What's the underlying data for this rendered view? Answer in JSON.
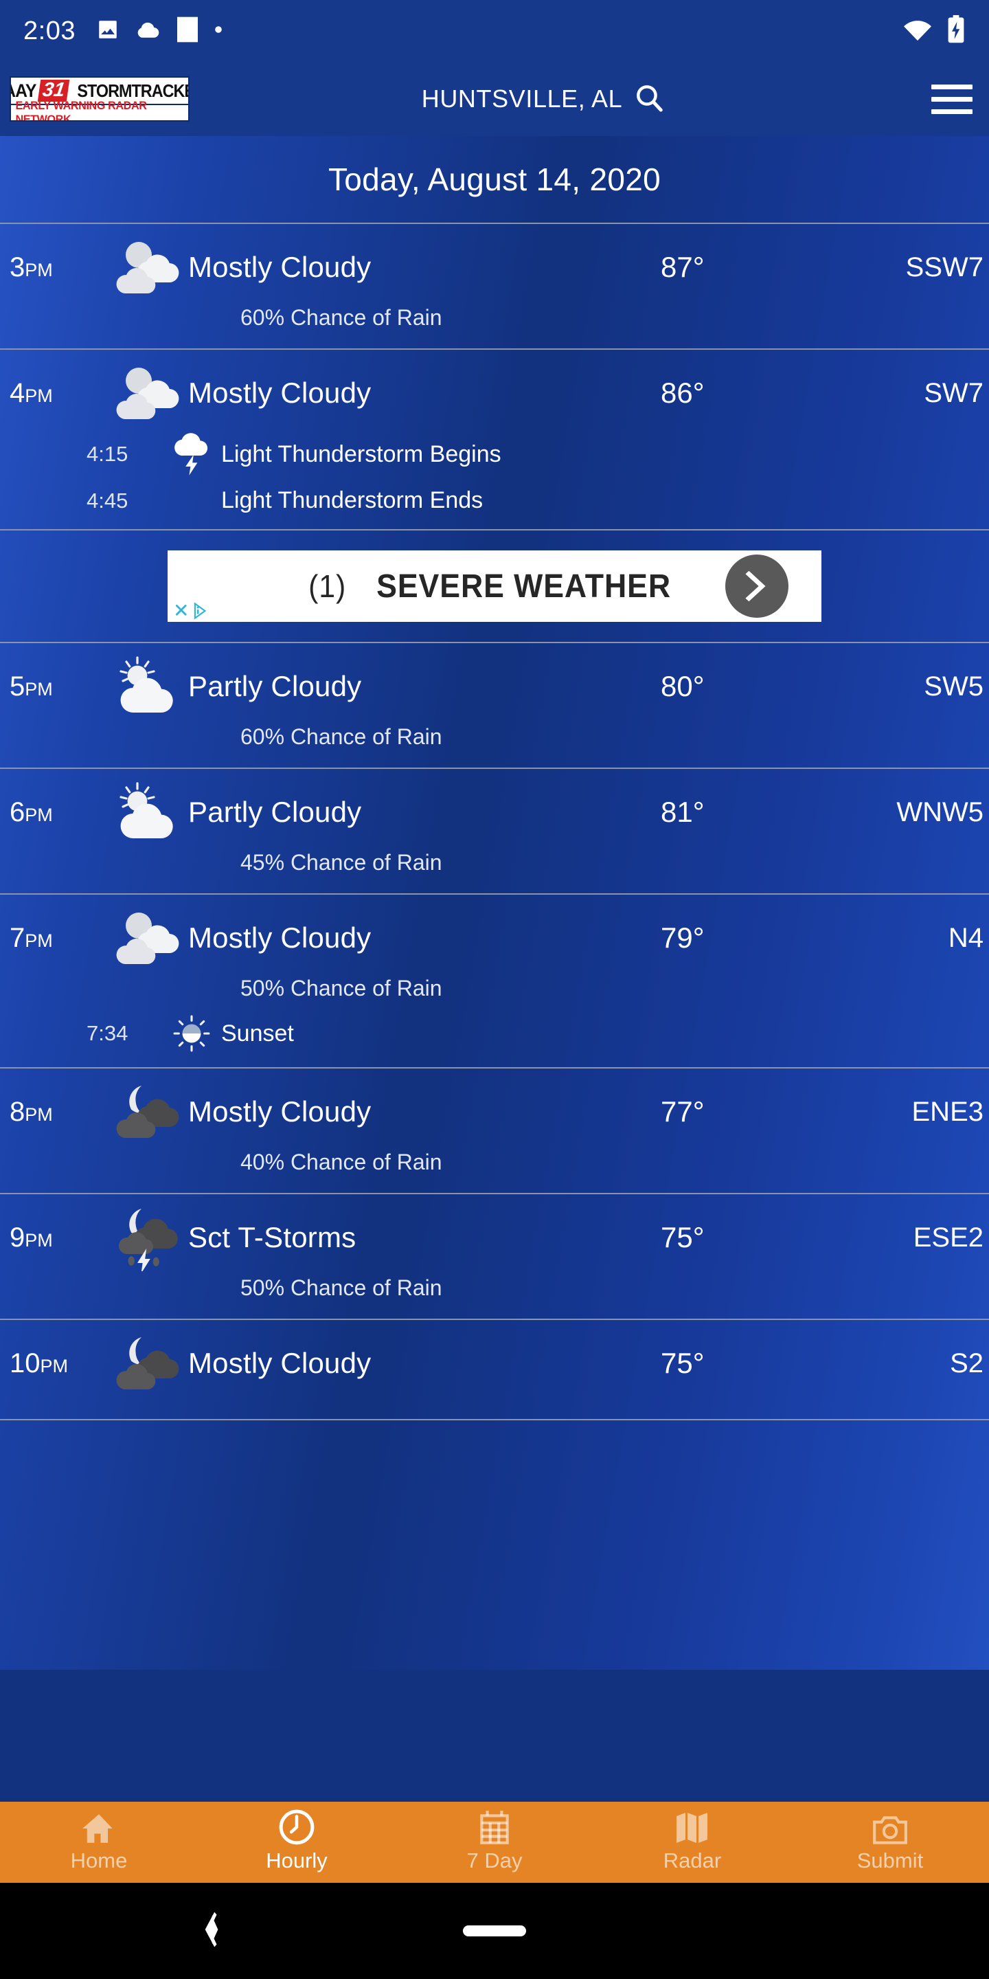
{
  "status_bar": {
    "time": "2:03",
    "left_icons": [
      "image-icon",
      "cloud-icon",
      "square-notification-icon",
      "dot-icon"
    ],
    "right_icons": [
      "wifi-icon",
      "battery-charging-icon"
    ]
  },
  "header": {
    "logo": {
      "brand": "WAAY",
      "channel": "31",
      "product": "STORMTRACKER",
      "tagline": "EARLY WARNING RADAR NETWORK"
    },
    "location": "HUNTSVILLE, AL",
    "search_icon": "search-icon",
    "menu_icon": "hamburger-menu-icon"
  },
  "date_header": "Today, August 14, 2020",
  "hours": [
    {
      "time": "3",
      "meridiem": "PM",
      "icon": "mostly-cloudy-icon",
      "condition": "Mostly Cloudy",
      "temperature": "87°",
      "wind": "SSW7",
      "rain": "60% Chance of Rain",
      "events": []
    },
    {
      "time": "4",
      "meridiem": "PM",
      "icon": "mostly-cloudy-icon",
      "condition": "Mostly Cloudy",
      "temperature": "86°",
      "wind": "SW7",
      "rain": null,
      "events": [
        {
          "time": "4:15",
          "icon": "thunderstorm-icon",
          "label": "Light Thunderstorm Begins"
        },
        {
          "time": "4:45",
          "icon": null,
          "label": "Light Thunderstorm Ends"
        }
      ]
    },
    {
      "time": "5",
      "meridiem": "PM",
      "icon": "partly-cloudy-day-icon",
      "condition": "Partly Cloudy",
      "temperature": "80°",
      "wind": "SW5",
      "rain": "60% Chance of Rain",
      "events": []
    },
    {
      "time": "6",
      "meridiem": "PM",
      "icon": "partly-cloudy-day-icon",
      "condition": "Partly Cloudy",
      "temperature": "81°",
      "wind": "WNW5",
      "rain": "45% Chance of Rain",
      "events": []
    },
    {
      "time": "7",
      "meridiem": "PM",
      "icon": "mostly-cloudy-icon",
      "condition": "Mostly Cloudy",
      "temperature": "79°",
      "wind": "N4",
      "rain": "50% Chance of Rain",
      "events": [
        {
          "time": "7:34",
          "icon": "sunset-icon",
          "label": "Sunset"
        }
      ]
    },
    {
      "time": "8",
      "meridiem": "PM",
      "icon": "mostly-cloudy-night-icon",
      "condition": "Mostly Cloudy",
      "temperature": "77°",
      "wind": "ENE3",
      "rain": "40% Chance of Rain",
      "events": []
    },
    {
      "time": "9",
      "meridiem": "PM",
      "icon": "scattered-thunderstorms-night-icon",
      "condition": "Sct T-Storms",
      "temperature": "75°",
      "wind": "ESE2",
      "rain": "50% Chance of Rain",
      "events": []
    },
    {
      "time": "10",
      "meridiem": "PM",
      "icon": "mostly-cloudy-night-icon",
      "condition": "Mostly Cloudy",
      "temperature": "75°",
      "wind": "S2",
      "rain": null,
      "events": []
    }
  ],
  "ad": {
    "count_label": "(1)",
    "headline": "SEVERE WEATHER",
    "play_icon": "play-arrow-icon",
    "adchoices_close": "✕",
    "adchoices_icon": "adchoices-icon"
  },
  "bottom_nav": {
    "items": [
      {
        "label": "Home",
        "icon": "home-icon",
        "active": false
      },
      {
        "label": "Hourly",
        "icon": "clock-icon",
        "active": true
      },
      {
        "label": "7 Day",
        "icon": "calendar-icon",
        "active": false
      },
      {
        "label": "Radar",
        "icon": "map-icon",
        "active": false
      },
      {
        "label": "Submit",
        "icon": "camera-icon",
        "active": false
      }
    ]
  },
  "system_nav": {
    "back_icon": "back-chevron-icon",
    "home_icon": "home-pill-icon"
  },
  "colors": {
    "header_blue": "#17398c",
    "content_blue": "#12317e",
    "nav_orange": "#e58425",
    "logo_red": "#d81f26",
    "divider": "#8a93a8"
  }
}
